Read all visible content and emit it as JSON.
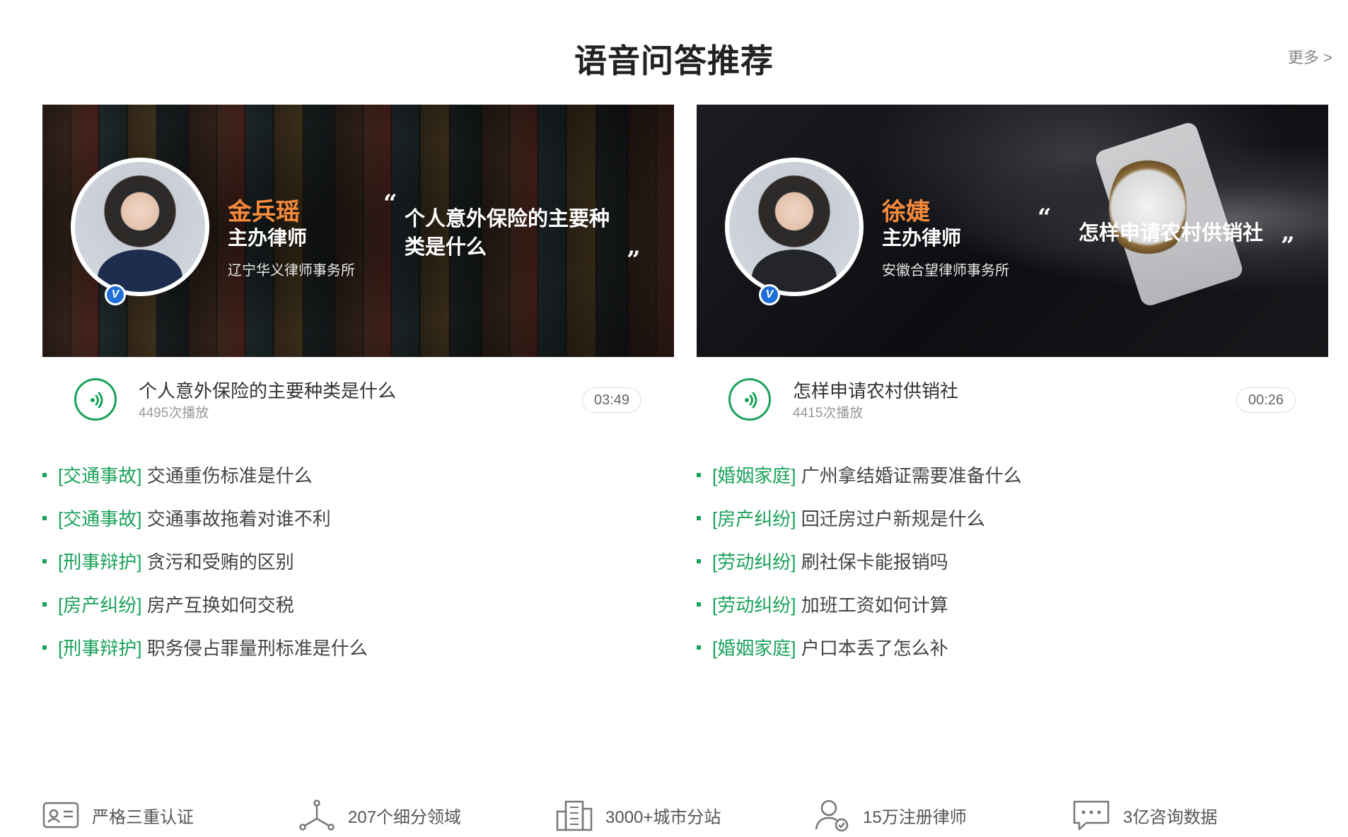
{
  "header": {
    "title": "语音问答推荐",
    "more_label": "更多 >"
  },
  "cards": [
    {
      "lawyer_name": "金兵瑶",
      "lawyer_title": "主办律师",
      "lawyer_firm": "辽宁华义律师事务所",
      "verify_badge": "V",
      "quote_open": "“",
      "quote_close": "”",
      "banner_question": "个人意外保险的主要种类是什么",
      "audio_title": "个人意外保险的主要种类是什么",
      "plays": "4495次播放",
      "duration": "03:49"
    },
    {
      "lawyer_name": "徐婕",
      "lawyer_title": "主办律师",
      "lawyer_firm": "安徽合望律师事务所",
      "verify_badge": "V",
      "quote_open": "“",
      "quote_close": "”",
      "banner_question": "怎样申请农村供销社",
      "audio_title": "怎样申请农村供销社",
      "plays": "4415次播放",
      "duration": "00:26"
    }
  ],
  "qa_left": [
    {
      "category": "[交通事故]",
      "text": "交通重伤标准是什么"
    },
    {
      "category": "[交通事故]",
      "text": "交通事故拖着对谁不利"
    },
    {
      "category": "[刑事辩护]",
      "text": "贪污和受贿的区别"
    },
    {
      "category": "[房产纠纷]",
      "text": "房产互换如何交税"
    },
    {
      "category": "[刑事辩护]",
      "text": "职务侵占罪量刑标准是什么"
    }
  ],
  "qa_right": [
    {
      "category": "[婚姻家庭]",
      "text": "广州拿结婚证需要准备什么"
    },
    {
      "category": "[房产纠纷]",
      "text": "回迁房过户新规是什么"
    },
    {
      "category": "[劳动纠纷]",
      "text": "刷社保卡能报销吗"
    },
    {
      "category": "[劳动纠纷]",
      "text": "加班工资如何计算"
    },
    {
      "category": "[婚姻家庭]",
      "text": "户口本丢了怎么补"
    }
  ],
  "features": [
    {
      "icon": "id-card-icon",
      "label": "严格三重认证"
    },
    {
      "icon": "network-nodes-icon",
      "label": "207个细分领域"
    },
    {
      "icon": "city-building-icon",
      "label": "3000+城市分站"
    },
    {
      "icon": "lawyer-verified-icon",
      "label": "15万注册律师"
    },
    {
      "icon": "chat-bubble-icon",
      "label": "3亿咨询数据"
    }
  ],
  "colors": {
    "accent_green": "#1aa25a",
    "name_orange": "#f58b3d",
    "verify_blue": "#1f6fd6"
  }
}
